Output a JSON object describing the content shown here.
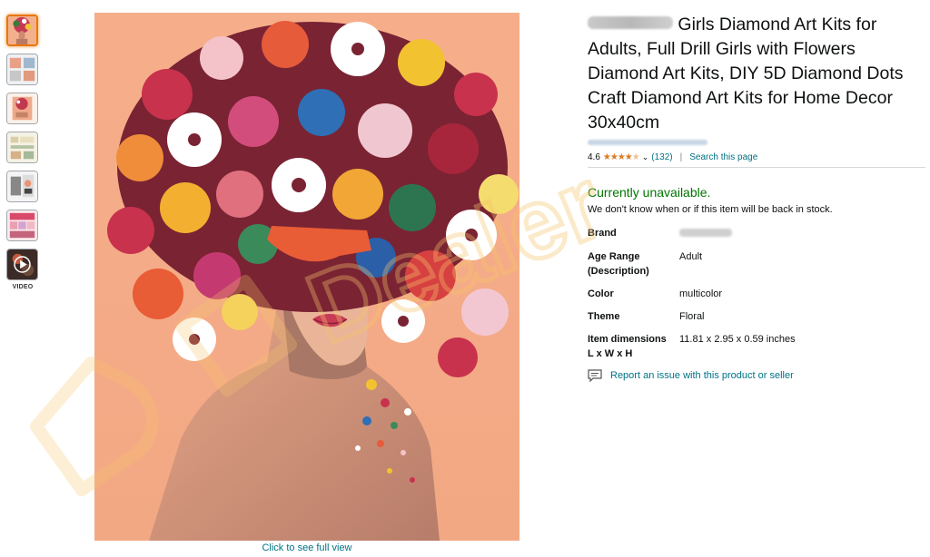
{
  "thumbnails": [
    {
      "name": "thumb-1",
      "active": true
    },
    {
      "name": "thumb-2"
    },
    {
      "name": "thumb-3"
    },
    {
      "name": "thumb-4"
    },
    {
      "name": "thumb-5"
    },
    {
      "name": "thumb-6"
    },
    {
      "name": "thumb-video"
    }
  ],
  "video_label": "VIDEO",
  "full_view_link": "Click to see full view",
  "product": {
    "title": "Girls Diamond Art Kits for Adults, Full Drill Girls with Flowers Diamond Art Kits, DIY 5D Diamond Dots Craft Diamond Art Kits for Home Decor 30x40cm",
    "rating": "4.6",
    "stars": 4.6,
    "reviews": "(132)",
    "separator": "|",
    "search_page": "Search this page",
    "availability": "Currently unavailable.",
    "availability_note": "We don't know when or if this item will be back in stock."
  },
  "specs": [
    {
      "key": "Brand",
      "value": ""
    },
    {
      "key": "Age Range (Description)",
      "value": "Adult"
    },
    {
      "key": "Color",
      "value": "multicolor"
    },
    {
      "key": "Theme",
      "value": "Floral"
    },
    {
      "key": "Item dimensions L x W x H",
      "value": "11.81 x 2.95 x 0.59 inches"
    }
  ],
  "report_link": "Report an issue with this product or seller",
  "colors": {
    "link": "#007185",
    "available_green": "#007600",
    "star": "#de7921",
    "thumb_active": "#e77600",
    "watermark": "#f6c56a"
  },
  "icons": {
    "stars": "star-rating-icon",
    "chevron": "chevron-down-icon",
    "report": "feedback-icon",
    "play": "play-icon"
  }
}
